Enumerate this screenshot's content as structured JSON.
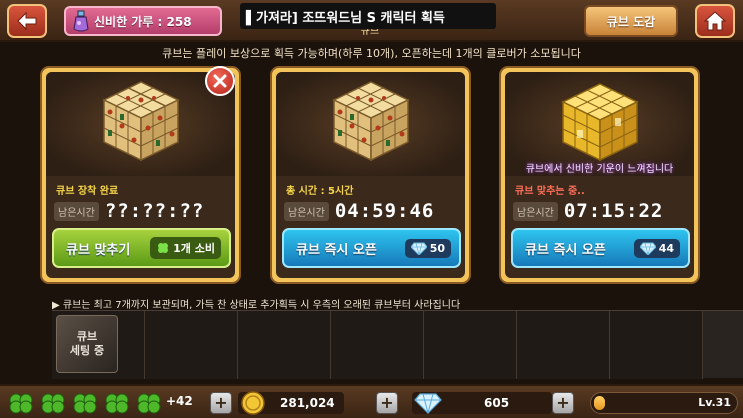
{
  "topbar": {
    "powder_label": "신비한 가루 : 258",
    "ticker": "▌가져라] 조뜨워드님 S 캐릭터 획득",
    "ticker_sub": "큐브",
    "dex_label": "큐브 도감"
  },
  "notice": "큐브는 플레이 보상으로 획득 가능하며(하루 10개), 오픈하는데 1개의 클로버가 소모됩니다",
  "cards": [
    {
      "status": "큐브 장착 완료",
      "time_label": "남은시간",
      "time_value": "??:??:??",
      "button_label": "큐브 맞추기",
      "cost": "1개 소비",
      "glow_text": ""
    },
    {
      "status": "총 시간 : 5시간",
      "time_label": "남은시간",
      "time_value": "04:59:46",
      "button_label": "큐브 즉시 오픈",
      "cost": "50",
      "glow_text": ""
    },
    {
      "status": "큐브 맞추는 중..",
      "time_label": "남은시간",
      "time_value": "07:15:22",
      "button_label": "큐브 즉시 오픈",
      "cost": "44",
      "glow_text": "큐브에서 신비한 기운이 느껴집니다"
    }
  ],
  "storage": {
    "note": "▶ 큐브는 최고 7개까지 보관되며, 가득 찬 상태로 추가획득 시 우측의 오래된 큐브부터 사라집니다",
    "slot_label": "큐브\n세팅 중"
  },
  "bottombar": {
    "clover_bonus": "+42",
    "gold": "281,024",
    "gems": "605",
    "level": "Lv.31",
    "exp_fraction": 0.08
  },
  "colors": {
    "accent_gold": "#f3c45a",
    "button_green": "#7cb62a",
    "button_blue": "#1f9bd4",
    "pink_badge": "#c8507c"
  }
}
